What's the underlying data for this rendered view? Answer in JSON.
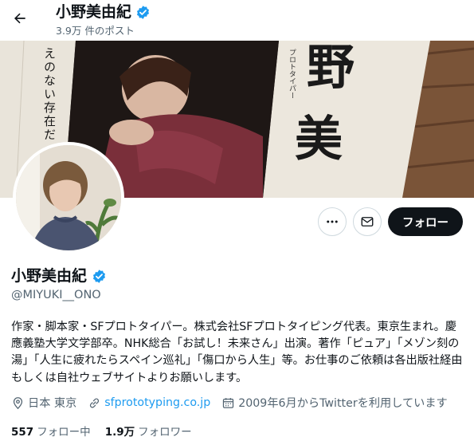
{
  "header": {
    "name": "小野美由紀",
    "post_count": "3.9万 件のポスト"
  },
  "banner": {
    "magazine_vertical_text": "えのない存在だ",
    "magazine_small_text": "プロトタイパー",
    "magazine_big_chars": [
      "野",
      "美"
    ]
  },
  "actions": {
    "follow_label": "フォロー"
  },
  "profile": {
    "name": "小野美由紀",
    "handle": "@MIYUKI__ONO",
    "bio": "作家・脚本家・SFプロトタイパー。株式会社SFプロトタイピング代表。東京生まれ。慶應義塾大学文学部卒。NHK総合「お試し！未来さん」出演。著作「ピュア」「メゾン刻の湯」「人生に疲れたらスペイン巡礼」「傷口から人生」等。お仕事のご依頼は各出版社経由もしくは自社ウェブサイトよりお願いします。",
    "location": "日本 東京",
    "website": "sfprototyping.co.jp",
    "joined": "2009年6月からTwitterを利用しています"
  },
  "stats": {
    "following_count": "557",
    "following_label": "フォロー中",
    "followers_count": "1.9万",
    "followers_label": "フォロワー"
  },
  "colors": {
    "accent": "#1d9bf0",
    "text": "#0f1419",
    "secondary": "#536471",
    "button_dark": "#0f1419"
  },
  "icons": [
    "back-arrow-icon",
    "verified-badge-icon",
    "more-icon",
    "mail-icon",
    "location-icon",
    "link-icon",
    "calendar-icon"
  ]
}
